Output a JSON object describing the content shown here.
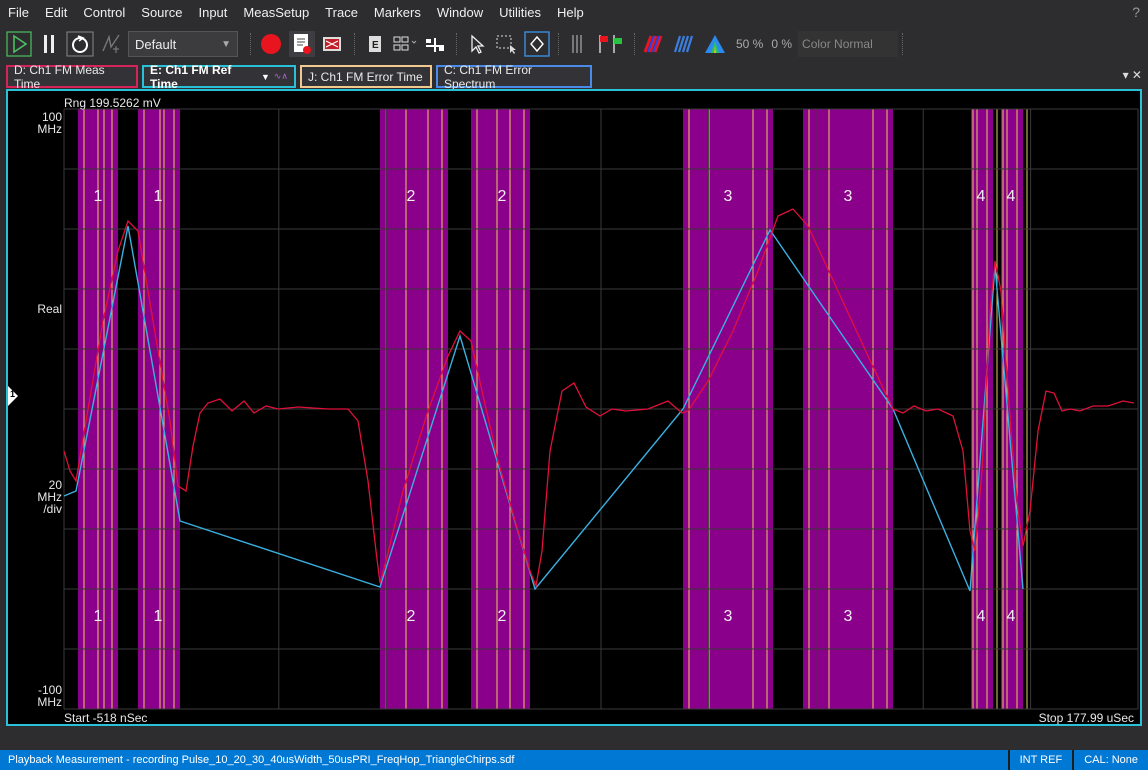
{
  "menu": [
    "File",
    "Edit",
    "Control",
    "Source",
    "Input",
    "MeasSetup",
    "Trace",
    "Markers",
    "Window",
    "Utilities",
    "Help"
  ],
  "menu_help_glyph": "?",
  "toolbar": {
    "preset": "Default",
    "zoom_pct": "50 %",
    "offset_pct": "0 %",
    "color_mode": "Color Normal"
  },
  "tabs": {
    "d": "D: Ch1 FM Meas Time",
    "e": "E: Ch1 FM Ref Time",
    "e_sub": "∿∧",
    "j": "J: Ch1 FM Error Time",
    "c": "C: Ch1 FM Error Spectrum",
    "controls": "▾ ✕"
  },
  "plot": {
    "range": "Rng 199.5262 mV",
    "y_top": "100\nMHz",
    "y_center": "Real",
    "y_scale": "20\nMHz\n/div",
    "y_bottom": "-100\nMHz",
    "x_start": "Start -518 nSec",
    "x_stop": "Stop 177.99 uSec",
    "marker": "1",
    "segment_labels": [
      "1",
      "1",
      "2",
      "2",
      "3",
      "3",
      "4",
      "4"
    ],
    "colors": {
      "band_fill": "#8b008b",
      "band_edge": "#e8c860",
      "trace_meas": "#e0103a",
      "trace_ref": "#3ab0e0",
      "grid": "#3a3a3a"
    }
  },
  "status": {
    "text": "Playback Measurement - recording Pulse_10_20_30_40usWidth_50usPRI_FreqHop_TriangleChirps.sdf",
    "int_ref": "INT REF",
    "cal": "CAL: None"
  }
}
